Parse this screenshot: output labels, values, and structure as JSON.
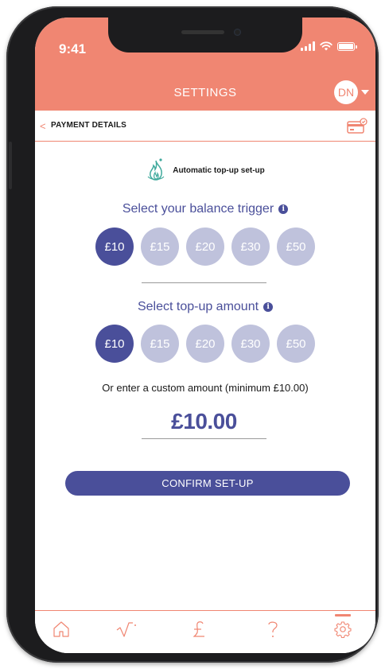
{
  "status_bar": {
    "time": "9:41"
  },
  "header": {
    "title": "SETTINGS",
    "avatar_initials": "DN"
  },
  "subheader": {
    "back_glyph": "<",
    "title": "PAYMENT DETAILS",
    "card_icon": "credit-card-icon"
  },
  "setup": {
    "icon": "flame-icon",
    "label": "Automatic top-up set-up"
  },
  "balance_trigger": {
    "title": "Select your balance trigger",
    "info": "i",
    "options": [
      "£10",
      "£15",
      "£20",
      "£30",
      "£50"
    ],
    "selected_index": 0
  },
  "topup_amount": {
    "title": "Select top-up amount",
    "info": "i",
    "options": [
      "£10",
      "£15",
      "£20",
      "£30",
      "£50"
    ],
    "selected_index": 0
  },
  "custom": {
    "label": "Or enter a custom amount (minimum £10.00)",
    "value": "£10.00"
  },
  "confirm_button": {
    "label": "CONFIRM SET-UP"
  },
  "tabbar": {
    "tabs": [
      {
        "icon": "home-icon"
      },
      {
        "icon": "sqrt-chart-icon"
      },
      {
        "icon": "pound-icon"
      },
      {
        "icon": "question-icon"
      },
      {
        "icon": "gear-icon",
        "active": true
      }
    ]
  },
  "colors": {
    "accent": "#f08672",
    "primary": "#4a4f9a",
    "chip_inactive": "#bfc2dc"
  }
}
